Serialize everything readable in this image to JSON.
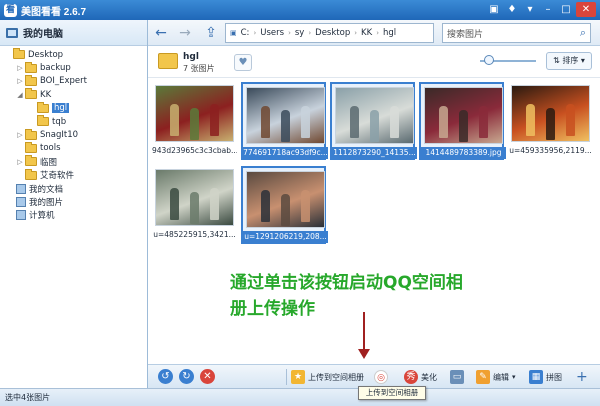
{
  "window": {
    "title": "美图看看 2.6.7",
    "logo": "看"
  },
  "sidebar": {
    "header": "我的电脑",
    "tree": [
      {
        "label": "Desktop",
        "level": 0,
        "arrow": "",
        "type": "folder"
      },
      {
        "label": "backup",
        "level": 1,
        "arrow": "▷",
        "type": "folder"
      },
      {
        "label": "BOI_Expert",
        "level": 1,
        "arrow": "▷",
        "type": "folder"
      },
      {
        "label": "KK",
        "level": 1,
        "arrow": "◢",
        "type": "folder"
      },
      {
        "label": "hgl",
        "level": 2,
        "arrow": "",
        "type": "folder",
        "selected": true
      },
      {
        "label": "tqb",
        "level": 2,
        "arrow": "",
        "type": "folder"
      },
      {
        "label": "SnagIt10",
        "level": 1,
        "arrow": "▷",
        "type": "folder"
      },
      {
        "label": "tools",
        "level": 1,
        "arrow": "",
        "type": "folder"
      },
      {
        "label": "临图",
        "level": 1,
        "arrow": "▷",
        "type": "folder"
      },
      {
        "label": "艾奇软件",
        "level": 1,
        "arrow": "",
        "type": "folder"
      },
      {
        "label": "我的文档",
        "level": 0,
        "arrow": "",
        "type": "special"
      },
      {
        "label": "我的图片",
        "level": 0,
        "arrow": "",
        "type": "special"
      },
      {
        "label": "计算机",
        "level": 0,
        "arrow": "",
        "type": "special"
      }
    ]
  },
  "nav": {
    "path": [
      "C:",
      "Users",
      "sy",
      "Desktop",
      "KK",
      "hgl"
    ],
    "search_placeholder": "搜索图片"
  },
  "folder": {
    "name": "hgl",
    "count": "7 张图片",
    "sort_label": "排序"
  },
  "thumbnails": [
    {
      "caption": "943d23965c3c3cbab...",
      "selected": false,
      "colors": [
        "#5a7a3a",
        "#8c2020",
        "#c8b070"
      ]
    },
    {
      "caption": "774691718ac93df9c...",
      "selected": true,
      "colors": [
        "#3a4a5a",
        "#c8d2dc",
        "#704830"
      ]
    },
    {
      "caption": "1112873290_14135...",
      "selected": true,
      "colors": [
        "#8aa0a8",
        "#d8dcd8",
        "#5a6a70"
      ]
    },
    {
      "caption": "1414489783389.jpg",
      "selected": true,
      "colors": [
        "#3a2a28",
        "#8a2a3a",
        "#c8a890"
      ]
    },
    {
      "caption": "u=459335956,2119...",
      "selected": false,
      "colors": [
        "#2a1a10",
        "#c85020",
        "#f0c060"
      ]
    },
    {
      "caption": "u=485225915,3421...",
      "selected": false,
      "colors": [
        "#6a7a6a",
        "#d0d4c8",
        "#3a4a40"
      ]
    },
    {
      "caption": "u=1291206219,208...",
      "selected": true,
      "colors": [
        "#5a4a40",
        "#c89070",
        "#2a3038"
      ]
    }
  ],
  "annotation": {
    "line1": "通过单击该按钮启动QQ空间相",
    "line2": "册上传操作"
  },
  "bottombar": {
    "upload_qzone": "上传到空间相册",
    "beautify": "美化",
    "edit": "编辑",
    "collage": "拼图"
  },
  "tooltip": "上传到空间相册",
  "status": "选中4张图片"
}
